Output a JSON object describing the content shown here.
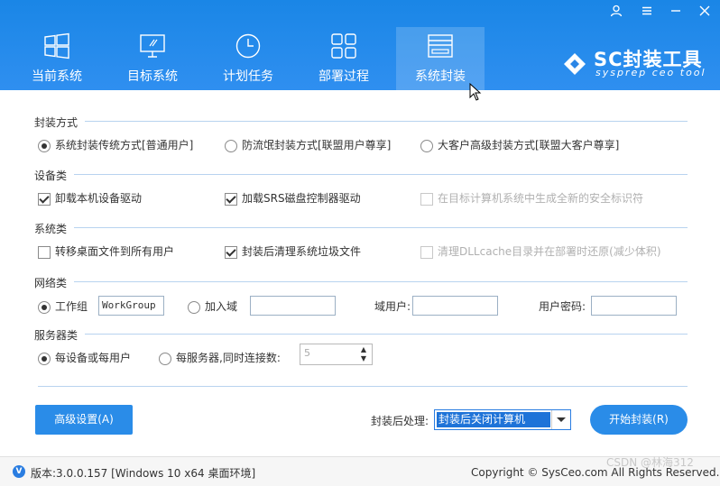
{
  "window": {
    "controls": [
      "user-icon",
      "menu-icon",
      "minimize-icon",
      "close-icon"
    ]
  },
  "nav": {
    "tabs": [
      {
        "label": "当前系统",
        "icon": "windows-logo-icon"
      },
      {
        "label": "目标系统",
        "icon": "monitor-icon"
      },
      {
        "label": "计划任务",
        "icon": "clock-icon"
      },
      {
        "label": "部署过程",
        "icon": "grid-icon"
      },
      {
        "label": "系统封装",
        "icon": "drive-icon",
        "active": true
      }
    ]
  },
  "logo": {
    "title": "SC封装工具",
    "subtitle": "sysprep ceo tool"
  },
  "sections": {
    "pack_mode": {
      "title": "封装方式",
      "options": [
        {
          "label": "系统封装传统方式[普通用户]",
          "selected": true
        },
        {
          "label": "防流氓封装方式[联盟用户尊享]",
          "selected": false
        },
        {
          "label": "大客户高级封装方式[联盟大客户尊享]",
          "selected": false
        }
      ]
    },
    "devices": {
      "title": "设备类",
      "options": [
        {
          "label": "卸载本机设备驱动",
          "checked": true,
          "enabled": true
        },
        {
          "label": "加载SRS磁盘控制器驱动",
          "checked": true,
          "enabled": true
        },
        {
          "label": "在目标计算机系统中生成全新的安全标识符",
          "checked": false,
          "enabled": false
        }
      ]
    },
    "system": {
      "title": "系统类",
      "options": [
        {
          "label": "转移桌面文件到所有用户",
          "checked": false,
          "enabled": true
        },
        {
          "label": "封装后清理系统垃圾文件",
          "checked": true,
          "enabled": true
        },
        {
          "label": "清理DLLcache目录并在部署时还原(减少体积)",
          "checked": false,
          "enabled": false
        }
      ]
    },
    "network": {
      "title": "网络类",
      "workgroup_label": "工作组",
      "workgroup_value": "WorkGroup",
      "domain_label": "加入域",
      "domain_value": "",
      "domain_user_label": "域用户:",
      "domain_user_value": "",
      "password_label": "用户密码:",
      "password_value": ""
    },
    "server": {
      "title": "服务器类",
      "per_device_label": "每设备或每用户",
      "per_server_label": "每服务器,同时连接数:",
      "connections_value": "5"
    }
  },
  "actions": {
    "advanced_label": "高级设置(A)",
    "post_label": "封装后处理:",
    "post_value": "封装后关闭计算机",
    "start_label": "开始封装(R)"
  },
  "footer": {
    "v_badge": "V",
    "version": "版本:3.0.0.157 [Windows 10 x64 桌面环境]",
    "copyright": "Copyright © SysCeo.com All Rights Reserved.",
    "watermark": "CSDN @林海312"
  },
  "colors": {
    "header": "#1a86e6",
    "accent": "#2a8ce8",
    "section_line": "#b8d3ef"
  }
}
